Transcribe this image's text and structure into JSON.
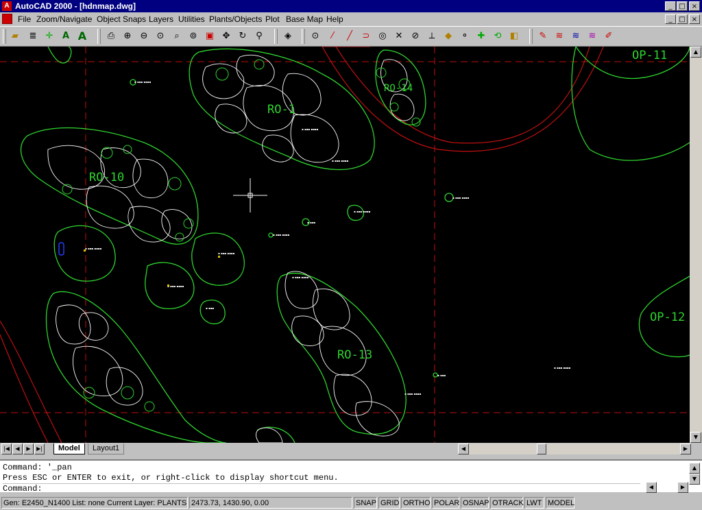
{
  "window": {
    "title": "AutoCAD 2000 - [hdnmap.dwg]",
    "title_controls": [
      "_",
      "□",
      "×"
    ],
    "doc_controls": [
      "_",
      "□",
      "×"
    ]
  },
  "menu": [
    "File",
    "Zoom/Navigate",
    "Object Snaps",
    "Layers",
    "Utilities",
    "Plants/Objects",
    "Plot",
    "Base Map",
    "Help"
  ],
  "toolbar_icons": [
    "open-icon",
    "layer-lines-icon",
    "snap-point-icon",
    "text-a-icon",
    "text-a-large-icon",
    "print-icon",
    "zoom-in-icon",
    "zoom-out-icon",
    "zoom-window-icon",
    "zoom-realtime-icon",
    "zoom-extents-icon",
    "zoom-previous-icon",
    "pan-icon",
    "regen-icon",
    "properties-icon",
    "layer-stack-icon",
    "circle-snap-icon",
    "endpoint-icon",
    "line-icon",
    "arc-icon",
    "center-icon",
    "intersection-icon",
    "tangent-icon",
    "perpendicular-icon",
    "quadrant-icon",
    "node-icon",
    "insert-icon",
    "nearest-icon",
    "apparent-icon",
    "brush-icon",
    "hatch-icon",
    "hatch2-icon",
    "hatch3-icon",
    "paint-icon"
  ],
  "drawing": {
    "colors": {
      "background": "#000000",
      "shapes": "#2fd52f",
      "gridlines": "#c01010",
      "plants": "#ffffff",
      "selected": "#2040ff"
    },
    "labels": [
      "OP-11",
      "OP-12",
      "RO-1",
      "RO-10",
      "RO-13",
      "RO-14"
    ]
  },
  "tabs": {
    "model": "Model",
    "layout": "Layout1"
  },
  "command": {
    "line1": "Command: '_pan",
    "line2": "Press ESC or ENTER to exit, or right-click to display shortcut menu.",
    "prompt": "Command:"
  },
  "status": {
    "info": "Gen: E2450_N1400  List: none Current Layer: PLANTS",
    "coords": "2473.73, 1430.90, 0.00",
    "toggles": [
      "SNAP",
      "GRID",
      "ORTHO",
      "POLAR",
      "OSNAP",
      "OTRACK",
      "LWT",
      "MODEL"
    ]
  }
}
